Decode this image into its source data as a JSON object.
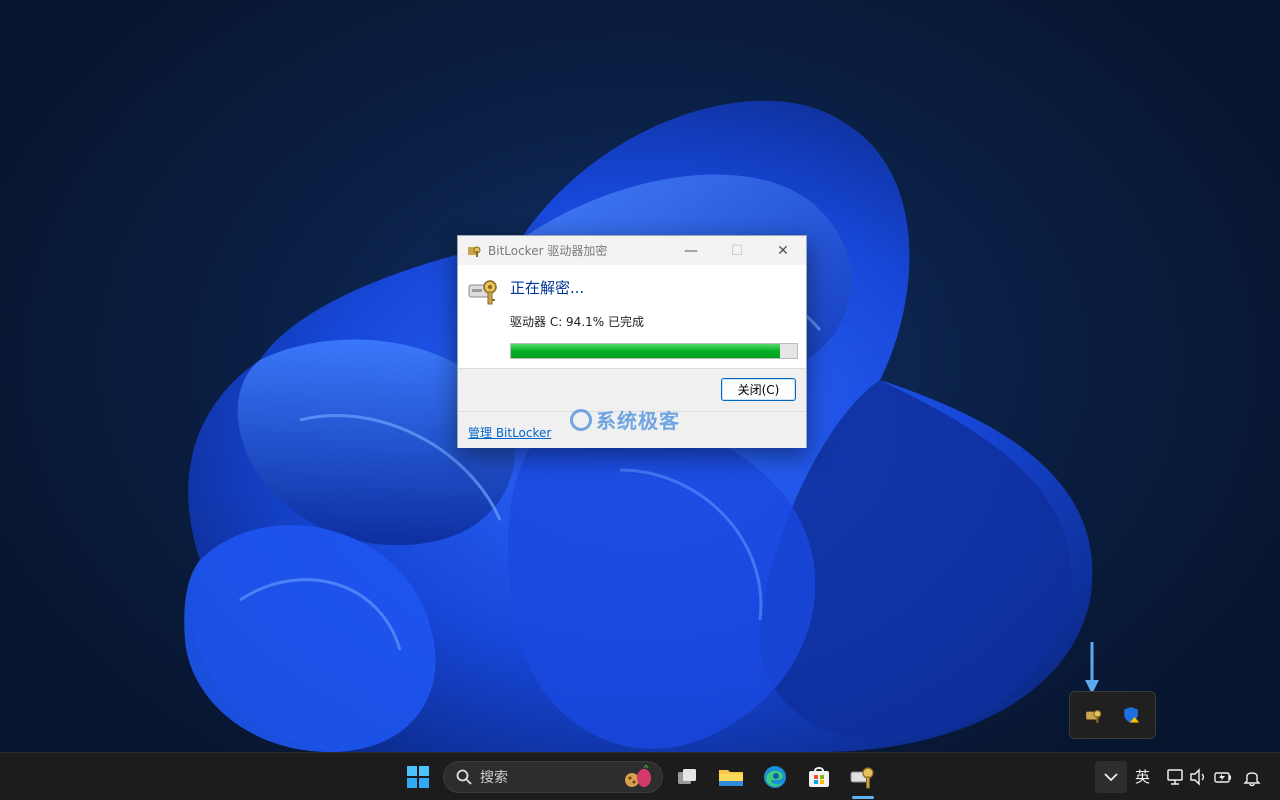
{
  "dialog": {
    "title": "BitLocker 驱动器加密",
    "heading": "正在解密...",
    "status": "驱动器 C: 94.1% 已完成",
    "progress_percent": 94.1,
    "close_label": "关闭(C)",
    "manage_link": "管理 BitLocker",
    "window_controls": {
      "minimize": "—",
      "maximize": "☐",
      "close": "✕"
    }
  },
  "watermark": {
    "text": "系统极客"
  },
  "tray_flyout": {
    "icons": [
      "bitlocker-icon",
      "defender-warning-icon"
    ]
  },
  "taskbar": {
    "search_placeholder": "搜索",
    "apps": [
      "start-icon",
      "task-view-icon",
      "file-explorer-icon",
      "edge-icon",
      "store-icon",
      "bitlocker-icon"
    ],
    "ime_label": "英",
    "system_icons": [
      "network-icon",
      "volume-icon",
      "battery-icon",
      "notification-bell-icon"
    ]
  },
  "colors": {
    "progress_green": "#06b025",
    "link_blue": "#0066cc",
    "heading_blue": "#003399",
    "taskbar_bg": "#1c1c1c"
  }
}
